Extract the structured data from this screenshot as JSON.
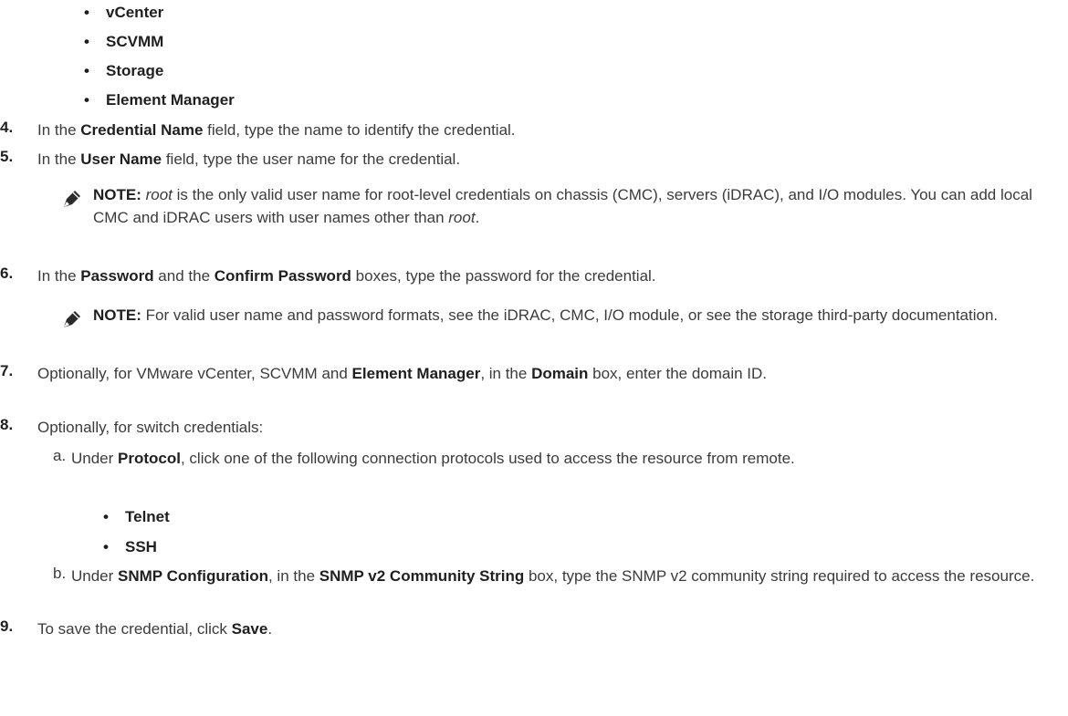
{
  "top_bullets": [
    "vCenter",
    "SCVMM",
    "Storage",
    "Element Manager"
  ],
  "step4": {
    "num": "4.",
    "a": "In the ",
    "b": "Credential Name",
    "c": " field, type the name to identify the credential."
  },
  "step5": {
    "num": "5.",
    "a": "In the ",
    "b": "User Name",
    "c": " field, type the user name for the credential."
  },
  "note1": {
    "label": "NOTE: ",
    "i1": "root",
    "t1": " is the only valid user name for root-level credentials on chassis (CMC), servers (iDRAC), and I/O modules. You can add local CMC and iDRAC users with user names other than ",
    "i2": "root",
    "t2": "."
  },
  "step6": {
    "num": "6.",
    "a": "In the ",
    "b": "Password",
    "c": " and the ",
    "d": "Confirm Password",
    "e": " boxes, type the password for the credential."
  },
  "note2": {
    "label": "NOTE: ",
    "t1": "For valid user name and password formats, see the iDRAC, CMC, I/O module, or see the storage third-party documentation."
  },
  "step7": {
    "num": "7.",
    "a": "Optionally, for VMware vCenter, SCVMM and ",
    "b": "Element Manager",
    "c": ", in the ",
    "d": "Domain",
    "e": " box, enter the domain ID."
  },
  "step8": {
    "num": "8.",
    "a": "Optionally, for switch credentials:"
  },
  "step8a": {
    "letter": "a.",
    "a": "Under ",
    "b": "Protocol",
    "c": ", click one of the following connection protocols used to access the resource from remote."
  },
  "protocols": [
    "Telnet",
    "SSH"
  ],
  "step8b": {
    "letter": "b.",
    "a": "Under ",
    "b": "SNMP Configuration",
    "c": ", in the ",
    "d": "SNMP v2 Community String",
    "e": " box, type the SNMP v2 community string required to access the resource."
  },
  "step9": {
    "num": "9.",
    "a": "To save the credential, click ",
    "b": "Save",
    "c": "."
  }
}
